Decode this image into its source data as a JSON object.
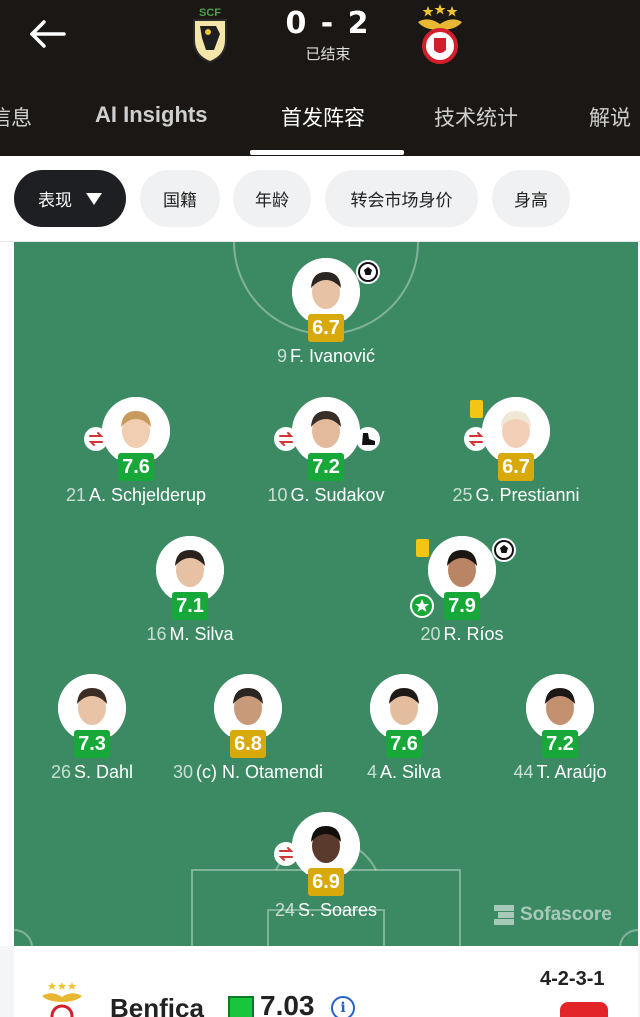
{
  "match": {
    "score": "0 - 2",
    "status": "已结束",
    "home_crest_icon": "scf-crest-icon",
    "away_crest_icon": "benfica-crest-icon"
  },
  "tabs": [
    {
      "label": "信息",
      "active": false
    },
    {
      "label": "AI Insights",
      "active": false
    },
    {
      "label": "首发阵容",
      "active": true
    },
    {
      "label": "技术统计",
      "active": false
    },
    {
      "label": "解说",
      "active": false
    }
  ],
  "filters": [
    {
      "label": "表现",
      "active": true
    },
    {
      "label": "国籍",
      "active": false
    },
    {
      "label": "年龄",
      "active": false
    },
    {
      "label": "转会市场身价",
      "active": false
    },
    {
      "label": "身高",
      "active": false
    }
  ],
  "colors": {
    "pitch": "#3c8a63",
    "rating_green": "#18a83a",
    "rating_yellow": "#d7a90b",
    "header_bg": "#1a1714"
  },
  "players": [
    {
      "number": "9",
      "name": "F. Ivanović",
      "rating": "6.7",
      "rating_color": "yellow",
      "badges": [
        "goal-icon"
      ]
    },
    {
      "number": "21",
      "name": "A. Schjelderup",
      "rating": "7.6",
      "rating_color": "green",
      "badges": [
        "substitution-icon"
      ]
    },
    {
      "number": "10",
      "name": "G. Sudakov",
      "rating": "7.2",
      "rating_color": "green",
      "badges": [
        "substitution-out-icon",
        "assist-boot-icon"
      ]
    },
    {
      "number": "25",
      "name": "G. Prestianni",
      "rating": "6.7",
      "rating_color": "yellow",
      "badges": [
        "yellow-card-icon",
        "substitution-icon"
      ]
    },
    {
      "number": "16",
      "name": "M. Silva",
      "rating": "7.1",
      "rating_color": "green",
      "badges": []
    },
    {
      "number": "20",
      "name": "R. Ríos",
      "rating": "7.9",
      "rating_color": "green",
      "badges": [
        "yellow-card-icon",
        "goal-icon",
        "star-icon"
      ]
    },
    {
      "number": "26",
      "name": "S. Dahl",
      "rating": "7.3",
      "rating_color": "green",
      "badges": []
    },
    {
      "number": "30",
      "name": "(c) N. Otamendi",
      "rating": "6.8",
      "rating_color": "yellow",
      "badges": []
    },
    {
      "number": "4",
      "name": "A. Silva",
      "rating": "7.6",
      "rating_color": "green",
      "badges": []
    },
    {
      "number": "44",
      "name": "T. Araújo",
      "rating": "7.2",
      "rating_color": "green",
      "badges": []
    },
    {
      "number": "24",
      "name": "S. Soares",
      "rating": "6.9",
      "rating_color": "yellow",
      "badges": [
        "substitution-out-icon"
      ]
    }
  ],
  "watermark": "Sofascore",
  "team_bar": {
    "name": "Benfica",
    "rating": "7.03",
    "formation": "4-2-3-1",
    "crest_icon": "benfica-crest-icon",
    "info_icon": "info-icon",
    "jersey_icon": "jersey-icon"
  }
}
